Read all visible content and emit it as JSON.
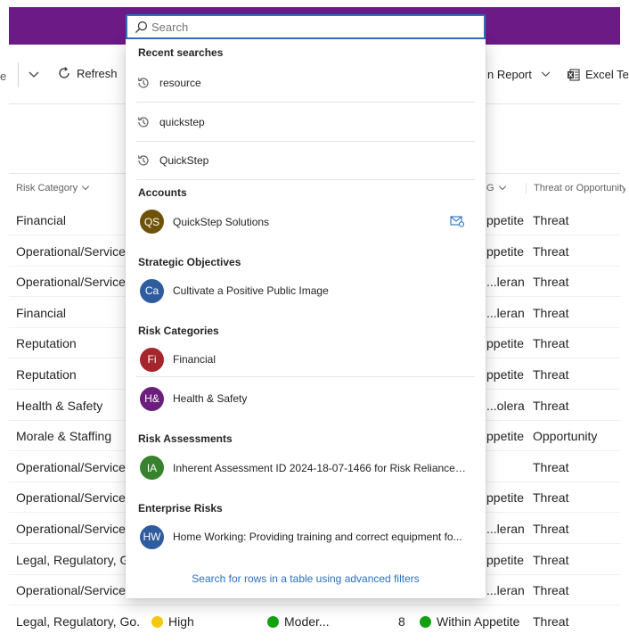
{
  "search": {
    "placeholder": "Search",
    "recent_title": "Recent searches",
    "recent": [
      "resource",
      "quickstep",
      "QuickStep"
    ],
    "sections": [
      {
        "title": "Accounts",
        "items": [
          {
            "initials": "QS",
            "color": "#6e5207",
            "text": "QuickStep Solutions",
            "has_mail": true
          }
        ]
      },
      {
        "title": "Strategic Objectives",
        "items": [
          {
            "initials": "Ca",
            "color": "#2f5c9e",
            "text": "Cultivate a Positive Public Image"
          }
        ]
      },
      {
        "title": "Risk Categories",
        "items": [
          {
            "initials": "Fi",
            "color": "#a4262c",
            "text": "Financial"
          },
          {
            "initials": "H&",
            "color": "#6b1f7c",
            "text": "Health & Safety"
          }
        ]
      },
      {
        "title": "Risk Assessments",
        "items": [
          {
            "initials": "IA",
            "color": "#37822c",
            "text": "Inherent Assessment ID 2024-18-07-1466 for Risk Reliance o..."
          }
        ]
      },
      {
        "title": "Enterprise Risks",
        "items": [
          {
            "initials": "HW",
            "color": "#2f5c9e",
            "text": "Home Working: Providing training and correct equipment fo..."
          }
        ]
      }
    ],
    "advanced_link": "Search for rows in a table using advanced filters"
  },
  "commandbar": {
    "left_fragment": "e",
    "refresh": "Refresh",
    "report": "n Report",
    "excel": "Excel Te"
  },
  "grid": {
    "headers": {
      "risk_category": "Risk Category",
      "rag_fragment": "G",
      "threat": "Threat or Opportunity"
    },
    "rows": [
      {
        "category": "Financial",
        "appetite": "ppetite",
        "threat": "Threat"
      },
      {
        "category": "Operational/Service C",
        "appetite": "ppetite",
        "threat": "Threat"
      },
      {
        "category": "Operational/Service C",
        "appetite": "leran...",
        "threat": "Threat"
      },
      {
        "category": "Financial",
        "appetite": "leran...",
        "threat": "Threat"
      },
      {
        "category": "Reputation",
        "appetite": "ppetite",
        "threat": "Threat"
      },
      {
        "category": "Reputation",
        "appetite": "ppetite",
        "threat": "Threat"
      },
      {
        "category": "Health & Safety",
        "appetite": "olera...",
        "threat": "Threat"
      },
      {
        "category": "Morale & Staffing",
        "appetite": "ppetite",
        "threat": "Opportunity"
      },
      {
        "category": "Operational/Service C",
        "appetite": "",
        "threat": "Threat"
      },
      {
        "category": "Operational/Service C",
        "appetite": "ppetite",
        "threat": "Threat"
      },
      {
        "category": "Operational/Service C",
        "appetite": "leran...",
        "threat": "Threat"
      },
      {
        "category": "Legal, Regulatory, Go",
        "appetite": "ppetite",
        "threat": "Threat"
      },
      {
        "category": "Operational/Service C",
        "appetite": "leran...",
        "threat": "Threat"
      }
    ],
    "last_row": {
      "category": "Legal, Regulatory, Go...",
      "likelihood": "High",
      "likelihood_color": "#f2c811",
      "impact": "Moder...",
      "impact_color": "#13a10e",
      "score": "8",
      "rag": "Within Appetite",
      "rag_color": "#13a10e",
      "threat": "Threat"
    }
  }
}
